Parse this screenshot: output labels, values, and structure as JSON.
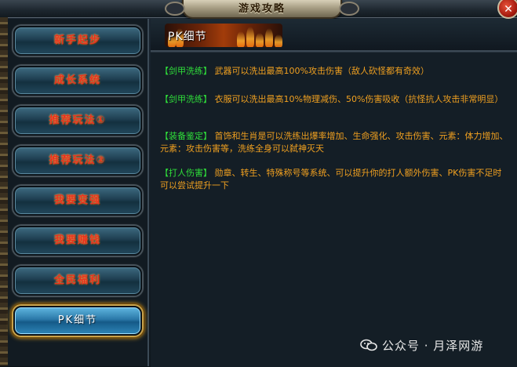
{
  "window": {
    "title": "游戏攻略",
    "close_symbol": "✕"
  },
  "sidebar": {
    "items": [
      {
        "label": "新手起步",
        "active": false
      },
      {
        "label": "成长系统",
        "active": false
      },
      {
        "label": "推荐玩法①",
        "active": false
      },
      {
        "label": "推荐玩法②",
        "active": false
      },
      {
        "label": "我要变强",
        "active": false
      },
      {
        "label": "我要赚钱",
        "active": false
      },
      {
        "label": "全民福利",
        "active": false
      },
      {
        "label": "PK细节",
        "active": true
      }
    ]
  },
  "main": {
    "section_title": "PK细节",
    "paragraphs": [
      {
        "tag": "【剑甲洗练】",
        "text": " 武器可以洗出最高100%攻击伤害（敌人砍怪都有奇效）"
      },
      {
        "tag": "【剑甲洗练】",
        "text": " 衣服可以洗出最高10%物理减伤、50%伤害吸收（抗怪抗人攻击非常明显）"
      },
      {
        "tag": "【装备鉴定】",
        "text": " 首饰和生肖是可以洗练出爆率增加、生命强化、攻击伤害、元素：体力增加、元素：攻击伤害等，洗练全身可以弑神灭天"
      },
      {
        "tag": "【打人伤害】",
        "text": " 勋章、转生、特殊称号等系统、可以提升你的打人额外伤害、PK伤害不足时可以尝试提升一下"
      }
    ]
  },
  "watermark": {
    "text": "公众号 · 月泽网游",
    "icon": "wechat-icon"
  },
  "colors": {
    "tag_green": "#2fdf3a",
    "body_orange": "#f0a020",
    "button_label_red": "#e8321e",
    "active_glow": "#e0a020"
  }
}
